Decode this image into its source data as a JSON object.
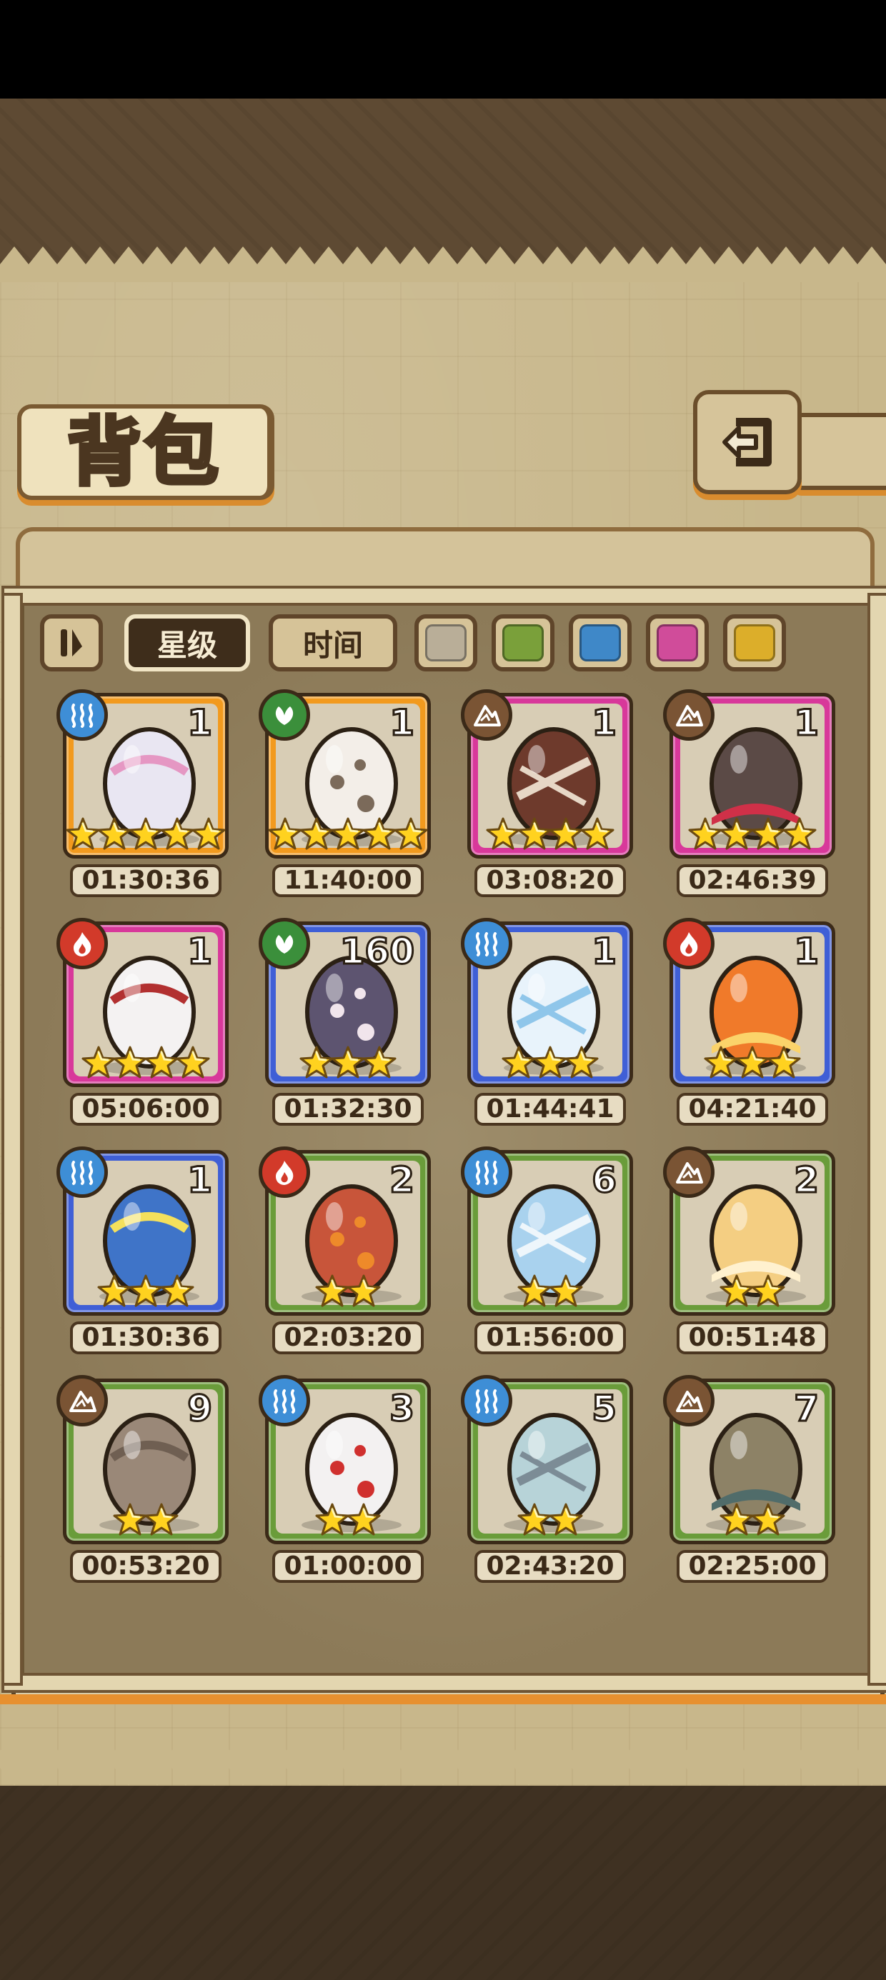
{
  "title": "背包",
  "toolbar": {
    "sort_toggle_icon": "pause-bars-icon",
    "star_tab": "星级",
    "time_tab": "时间",
    "active_tab": "星级"
  },
  "filters": [
    {
      "name": "gray",
      "color": "#b9ae98"
    },
    {
      "name": "green",
      "color": "#7aa03a"
    },
    {
      "name": "blue",
      "color": "#3f88c8"
    },
    {
      "name": "pink",
      "color": "#d04c9a"
    },
    {
      "name": "yellow",
      "color": "#dcae2a"
    }
  ],
  "element_colors": {
    "water": "#3e8ed6",
    "plant": "#3b8f3b",
    "earth": "#7a5434",
    "fire": "#d23a2a"
  },
  "rarity_colors": {
    "orange": "#f29a1e",
    "pink": "#d8389a",
    "blue": "#3f5fd6",
    "green": "#6a9c3a"
  },
  "items": [
    {
      "count": "1",
      "time": "01:30:36",
      "stars": 5,
      "element": "water",
      "rarity": "orange",
      "egg": "#e9e6f2",
      "accent": "#e597c3"
    },
    {
      "count": "1",
      "time": "11:40:00",
      "stars": 5,
      "element": "plant",
      "rarity": "orange",
      "egg": "#f3eee8",
      "accent": "#7b6a5a"
    },
    {
      "count": "1",
      "time": "03:08:20",
      "stars": 4,
      "element": "earth",
      "rarity": "pink",
      "egg": "#6e3a2c",
      "accent": "#e7d7c6"
    },
    {
      "count": "1",
      "time": "02:46:39",
      "stars": 4,
      "element": "earth",
      "rarity": "pink",
      "egg": "#5b4a46",
      "accent": "#d03048"
    },
    {
      "count": "1",
      "time": "05:06:00",
      "stars": 4,
      "element": "fire",
      "rarity": "pink",
      "egg": "#f4f2f2",
      "accent": "#b23030"
    },
    {
      "count": "160",
      "time": "01:32:30",
      "stars": 3,
      "element": "plant",
      "rarity": "blue",
      "egg": "#5d5470",
      "accent": "#f1e5ec"
    },
    {
      "count": "1",
      "time": "01:44:41",
      "stars": 3,
      "element": "water",
      "rarity": "blue",
      "egg": "#e8f3fb",
      "accent": "#8fc6ea"
    },
    {
      "count": "1",
      "time": "04:21:40",
      "stars": 3,
      "element": "fire",
      "rarity": "blue",
      "egg": "#f07a2a",
      "accent": "#fbd36a"
    },
    {
      "count": "1",
      "time": "01:30:36",
      "stars": 3,
      "element": "water",
      "rarity": "blue",
      "egg": "#3f74c8",
      "accent": "#f4e05c"
    },
    {
      "count": "2",
      "time": "02:03:20",
      "stars": 2,
      "element": "fire",
      "rarity": "green",
      "egg": "#c8553a",
      "accent": "#ee8a2a"
    },
    {
      "count": "6",
      "time": "01:56:00",
      "stars": 2,
      "element": "water",
      "rarity": "green",
      "egg": "#a9d2ee",
      "accent": "#eef6fb"
    },
    {
      "count": "2",
      "time": "00:51:48",
      "stars": 2,
      "element": "earth",
      "rarity": "green",
      "egg": "#f4ce82",
      "accent": "#fff1cf"
    },
    {
      "count": "9",
      "time": "00:53:20",
      "stars": 2,
      "element": "earth",
      "rarity": "green",
      "egg": "#9a8878",
      "accent": "#6f5f52"
    },
    {
      "count": "3",
      "time": "01:00:00",
      "stars": 2,
      "element": "water",
      "rarity": "green",
      "egg": "#f3f1f1",
      "accent": "#d0302e"
    },
    {
      "count": "5",
      "time": "02:43:20",
      "stars": 2,
      "element": "water",
      "rarity": "green",
      "egg": "#b7d3d8",
      "accent": "#7c8c96"
    },
    {
      "count": "7",
      "time": "02:25:00",
      "stars": 2,
      "element": "earth",
      "rarity": "green",
      "egg": "#8d8266",
      "accent": "#506c6a"
    }
  ],
  "icons": {
    "back": "back-arrow-icon",
    "water": "water-element-icon",
    "plant": "plant-element-icon",
    "earth": "earth-element-icon",
    "fire": "fire-element-icon",
    "star": "star-icon"
  }
}
